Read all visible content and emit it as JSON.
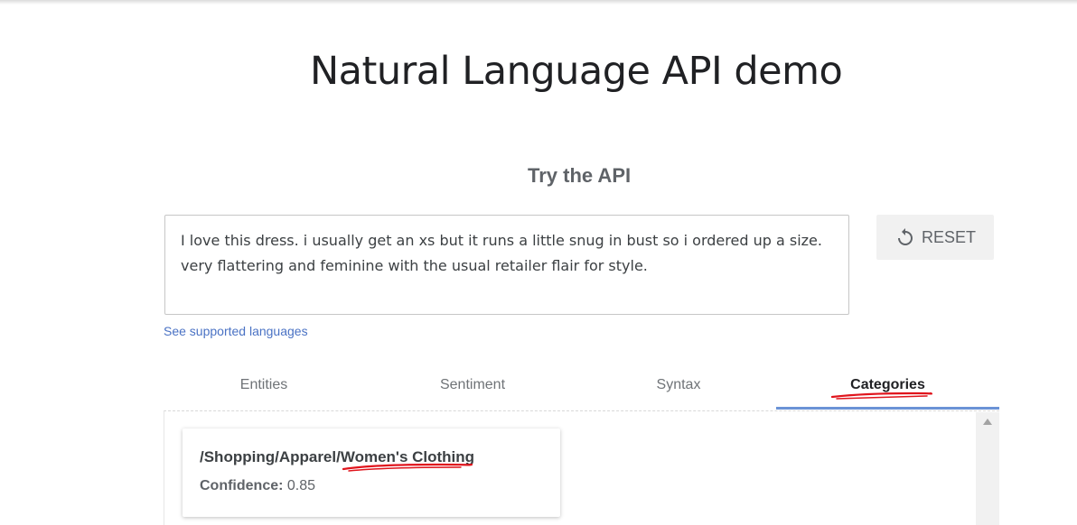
{
  "page": {
    "title": "Natural Language API demo",
    "section_title": "Try the API"
  },
  "input": {
    "text": "I love this dress. i usually get an xs but it runs a little snug in bust so i ordered up a size. very flattering and feminine with the usual retailer flair for style."
  },
  "reset_button": {
    "label": "RESET",
    "icon": "refresh-icon"
  },
  "languages_link": "See supported languages",
  "tabs": [
    {
      "label": "Entities",
      "active": false
    },
    {
      "label": "Sentiment",
      "active": false
    },
    {
      "label": "Syntax",
      "active": false
    },
    {
      "label": "Categories",
      "active": true
    }
  ],
  "results": {
    "category": "/Shopping/Apparel/Women's Clothing",
    "confidence_label": "Confidence:",
    "confidence_value": "0.85"
  },
  "colors": {
    "active_tab_indicator": "#6b93d6",
    "link": "#4a72c4",
    "annotation_underline": "#e0141c"
  }
}
